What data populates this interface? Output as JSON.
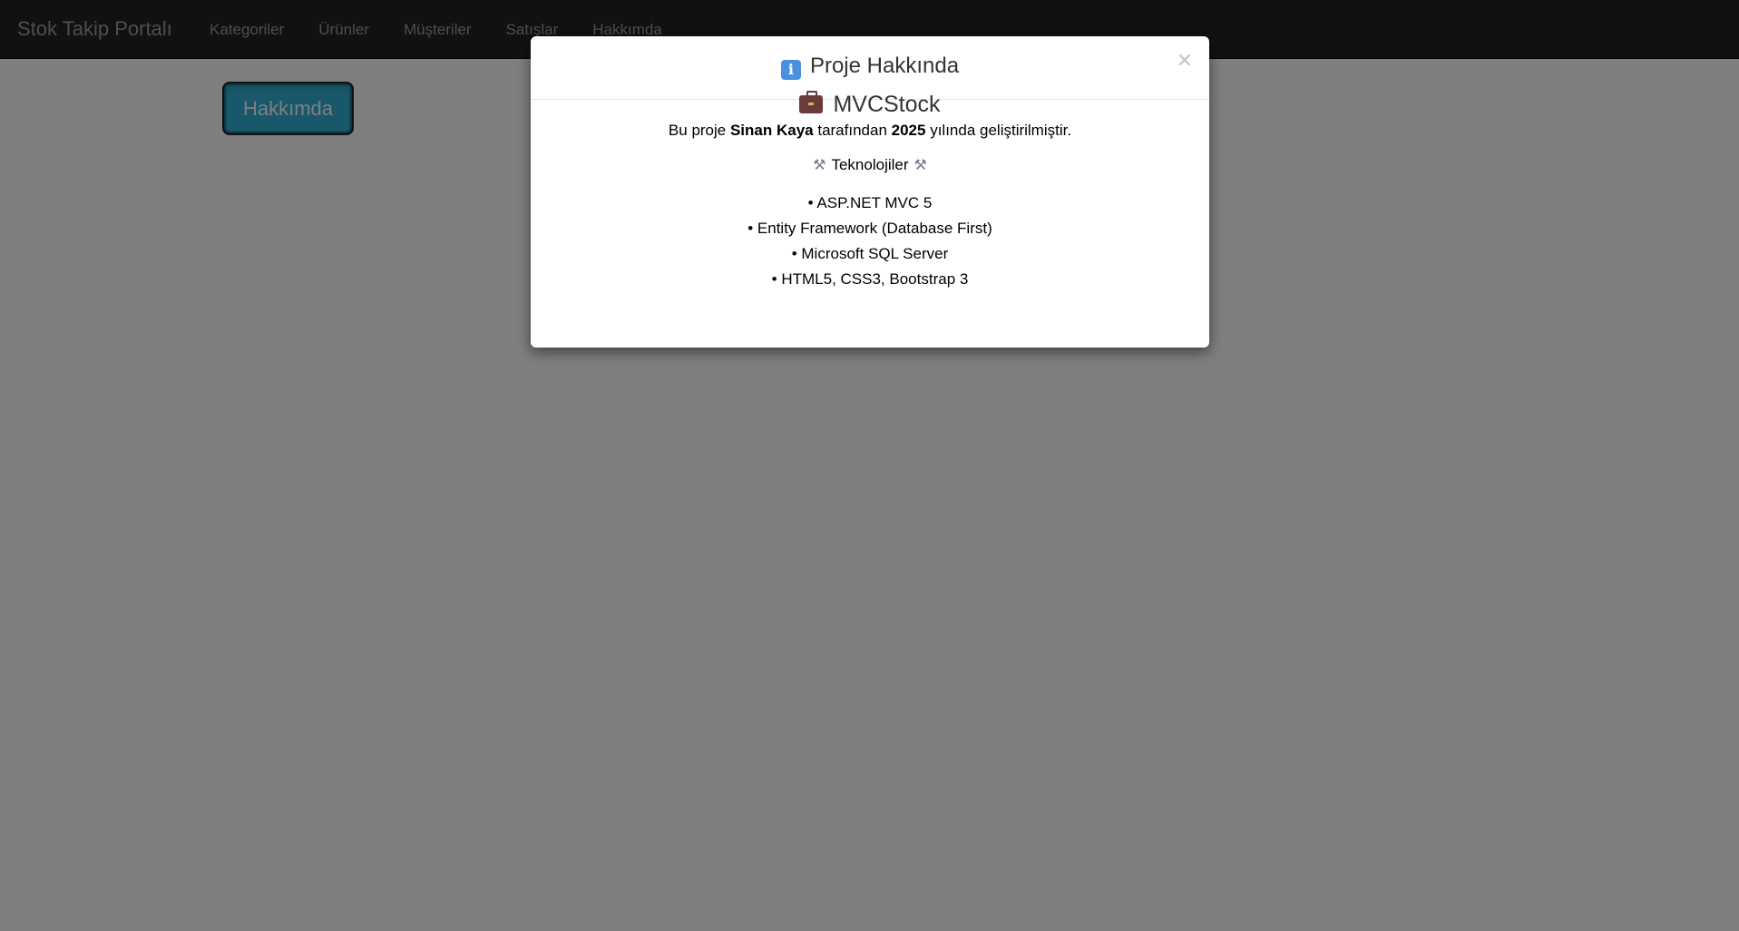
{
  "navbar": {
    "brand": "Stok Takip Portalı",
    "links": [
      "Kategoriler",
      "Ürünler",
      "Müşteriler",
      "Satışlar",
      "Hakkımda"
    ]
  },
  "page": {
    "about_button_label": "Hakkımda"
  },
  "modal": {
    "title": "Proje Hakkında",
    "title_icon": "info-icon",
    "close_label": "×",
    "project_name": "MVCStock",
    "project_icon": "briefcase-icon",
    "desc_prefix": "Bu proje ",
    "author": "Sinan Kaya",
    "desc_middle": " tarafından ",
    "year": "2025",
    "desc_suffix": " yılında geliştirilmiştir.",
    "tech_heading": "Teknolojiler",
    "tech_icon": "tools-icon",
    "technologies": [
      "• ASP.NET MVC 5",
      "• Entity Framework (Database First)",
      "• Microsoft SQL Server",
      "• HTML5, CSS3, Bootstrap 3"
    ]
  },
  "colors": {
    "navbar_bg": "#222222",
    "nav_text": "#9d9d9d",
    "button_bg": "#31b0d5",
    "backdrop_opacity": "0.5"
  }
}
